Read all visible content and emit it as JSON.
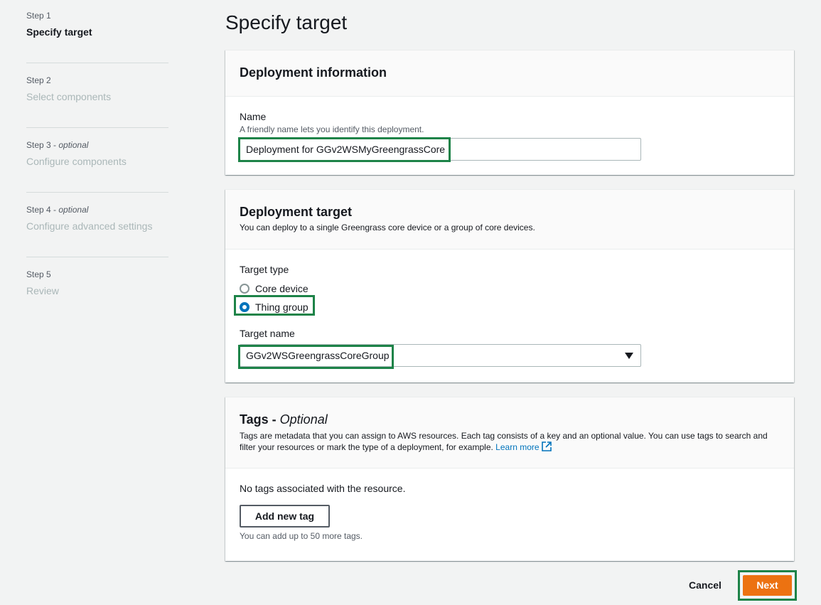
{
  "steps": [
    {
      "num": "Step 1",
      "optional": "",
      "title": "Specify target",
      "active": true
    },
    {
      "num": "Step 2",
      "optional": "",
      "title": "Select components",
      "active": false
    },
    {
      "num": "Step 3",
      "optional": "optional",
      "title": "Configure components",
      "active": false
    },
    {
      "num": "Step 4",
      "optional": "optional",
      "title": "Configure advanced settings",
      "active": false
    },
    {
      "num": "Step 5",
      "optional": "",
      "title": "Review",
      "active": false
    }
  ],
  "page_title": "Specify target",
  "deployment_info": {
    "heading": "Deployment information",
    "name_label": "Name",
    "name_help": "A friendly name lets you identify this deployment.",
    "name_value": "Deployment for GGv2WSMyGreengrassCore"
  },
  "deployment_target": {
    "heading": "Deployment target",
    "description": "You can deploy to a single Greengrass core device or a group of core devices.",
    "target_type_label": "Target type",
    "options": [
      "Core device",
      "Thing group"
    ],
    "selected": "Thing group",
    "target_name_label": "Target name",
    "target_name_value": "GGv2WSGreengrassCoreGroup"
  },
  "tags": {
    "heading": "Tags - ",
    "heading_optional": "Optional",
    "description": "Tags are metadata that you can assign to AWS resources. Each tag consists of a key and an optional value. You can use tags to search and filter your resources or mark the type of a deployment, for example.",
    "learn_more": "Learn more",
    "empty_text": "No tags associated with the resource.",
    "add_button": "Add new tag",
    "limit_text": "You can add up to 50 more tags."
  },
  "footer": {
    "cancel": "Cancel",
    "next": "Next"
  },
  "colors": {
    "accent": "#ec7211",
    "highlight": "#1d8348",
    "link": "#0073bb"
  }
}
